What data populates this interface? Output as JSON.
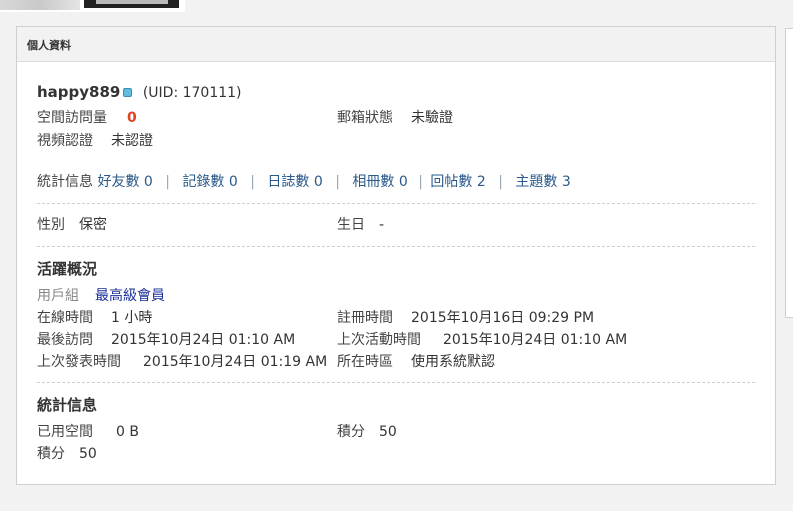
{
  "window": {
    "panel_title": "個人資料"
  },
  "profile": {
    "username": "happy889",
    "uid_text": "(UID: 170111)",
    "space_visits_label": "空間訪問量",
    "space_visits_value": "0",
    "email_status_label": "郵箱狀態",
    "email_status_value": "未驗證",
    "video_auth_label": "視頻認證",
    "video_auth_value": "未認證"
  },
  "stats_links": {
    "label": "統計信息",
    "items": [
      {
        "text": "好友數 0"
      },
      {
        "text": "記錄數 0"
      },
      {
        "text": "日誌數 0"
      },
      {
        "text": "相冊數 0"
      },
      {
        "text": "回帖數 2"
      },
      {
        "text": "主題數 3"
      }
    ],
    "separator": "|"
  },
  "personal": {
    "gender_label": "性別",
    "gender_value": "保密",
    "birthday_label": "生日",
    "birthday_value": "-"
  },
  "activity": {
    "heading": "活躍概況",
    "usergroup_label": "用戶組",
    "usergroup_value": "最高級會員",
    "online_time_label": "在線時間",
    "online_time_value": "1 小時",
    "register_time_label": "註冊時間",
    "register_time_value": "2015年10月16日 09:29 PM",
    "last_visit_label": "最後訪問",
    "last_visit_value": "2015年10月24日 01:10 AM",
    "last_activity_label": "上次活動時間",
    "last_activity_value": "2015年10月24日 01:10 AM",
    "last_post_label": "上次發表時間",
    "last_post_value": "2015年10月24日 01:19 AM",
    "timezone_label": "所在時區",
    "timezone_value": "使用系統默認"
  },
  "statistics": {
    "heading": "統計信息",
    "used_space_label": "已用空間",
    "used_space_value": "0 B",
    "points_label_right": "積分",
    "points_value_right": "50",
    "points_label_left": "積分",
    "points_value_left": "50"
  },
  "colors": {
    "link": "#2a5a8a",
    "visits_value": "#e0411e",
    "usergroup": "#1a2f9c",
    "online_indicator": "#5fbde0"
  }
}
